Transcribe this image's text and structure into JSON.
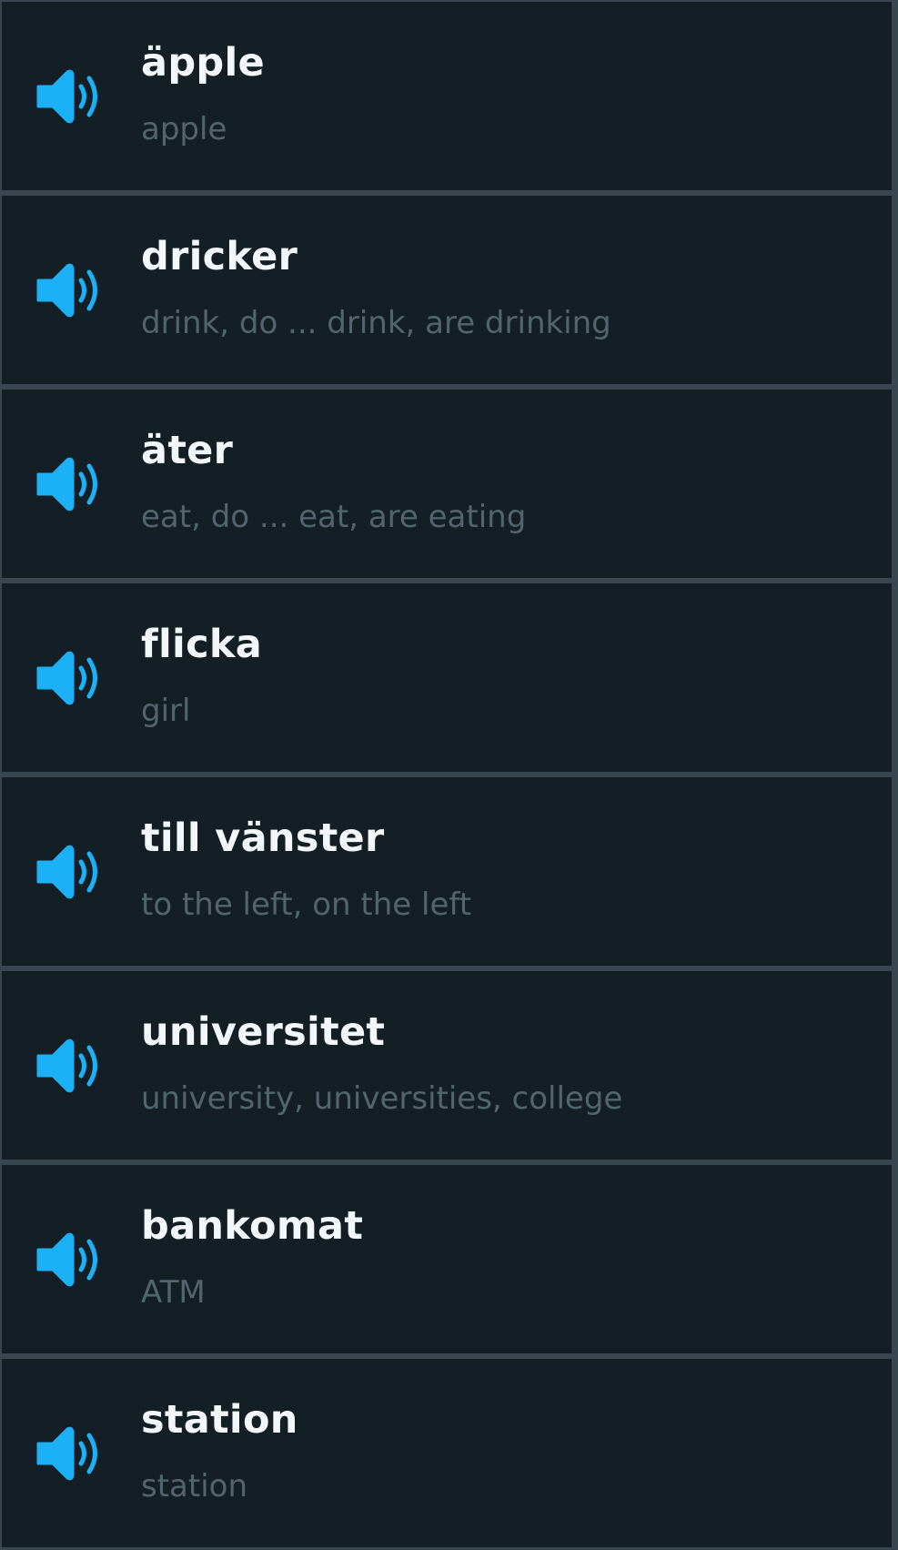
{
  "colors": {
    "background": "#131f24",
    "divider": "#37464f",
    "speaker_accent": "#1cb0f6",
    "term_text": "#f1f7fb",
    "translation_text": "#52656d"
  },
  "speaker_icon": "speaker-icon",
  "words": [
    {
      "term": "äpple",
      "translation": "apple"
    },
    {
      "term": "dricker",
      "translation": "drink, do ... drink, are drinking"
    },
    {
      "term": "äter",
      "translation": "eat, do ... eat, are eating"
    },
    {
      "term": "flicka",
      "translation": "girl"
    },
    {
      "term": "till vänster",
      "translation": "to the left, on the left"
    },
    {
      "term": "universitet",
      "translation": "university, universities, college"
    },
    {
      "term": "bankomat",
      "translation": "ATM"
    },
    {
      "term": "station",
      "translation": "station"
    }
  ]
}
